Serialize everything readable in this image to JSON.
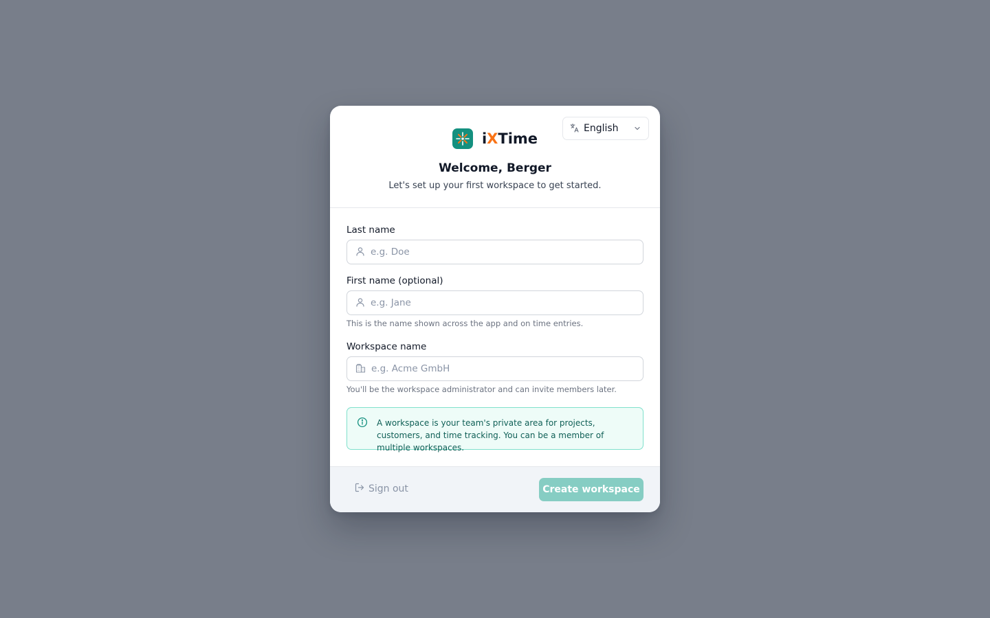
{
  "brand": {
    "name_prefix": "i",
    "name_x": "X",
    "name_suffix": "Time",
    "colors": {
      "mark": "#14907f",
      "accent": "#f97316"
    }
  },
  "language_select": {
    "icon": "translate-icon",
    "value": "English",
    "chevron_icon": "chevron-down-icon"
  },
  "header": {
    "welcome": "Welcome, Berger",
    "subtitle": "Let's set up your first workspace to get started."
  },
  "form": {
    "last_name": {
      "label": "Last name",
      "placeholder": "e.g. Doe",
      "icon": "user-icon",
      "value": ""
    },
    "first_name": {
      "label": "First name (optional)",
      "placeholder": "e.g. Jane",
      "icon": "user-icon",
      "value": "",
      "hint": "This is the name shown across the app and on time entries."
    },
    "workspace_name": {
      "label": "Workspace name",
      "placeholder": "e.g. Acme GmbH",
      "icon": "building-icon",
      "value": "",
      "hint": "You'll be the workspace administrator and can invite members later."
    }
  },
  "info": {
    "icon": "info-icon",
    "text": "A workspace is your team's private area for projects, customers, and time tracking. You can be a member of multiple workspaces."
  },
  "footer": {
    "sign_out_label": "Sign out",
    "sign_out_icon": "sign-out-icon",
    "create_label": "Create workspace",
    "create_button_color": "#86cdc3"
  },
  "colors": {
    "backdrop": "#787e8a",
    "info_border": "#7fe0cc",
    "info_background": "#eefcf8",
    "info_text": "#0f5f56"
  }
}
